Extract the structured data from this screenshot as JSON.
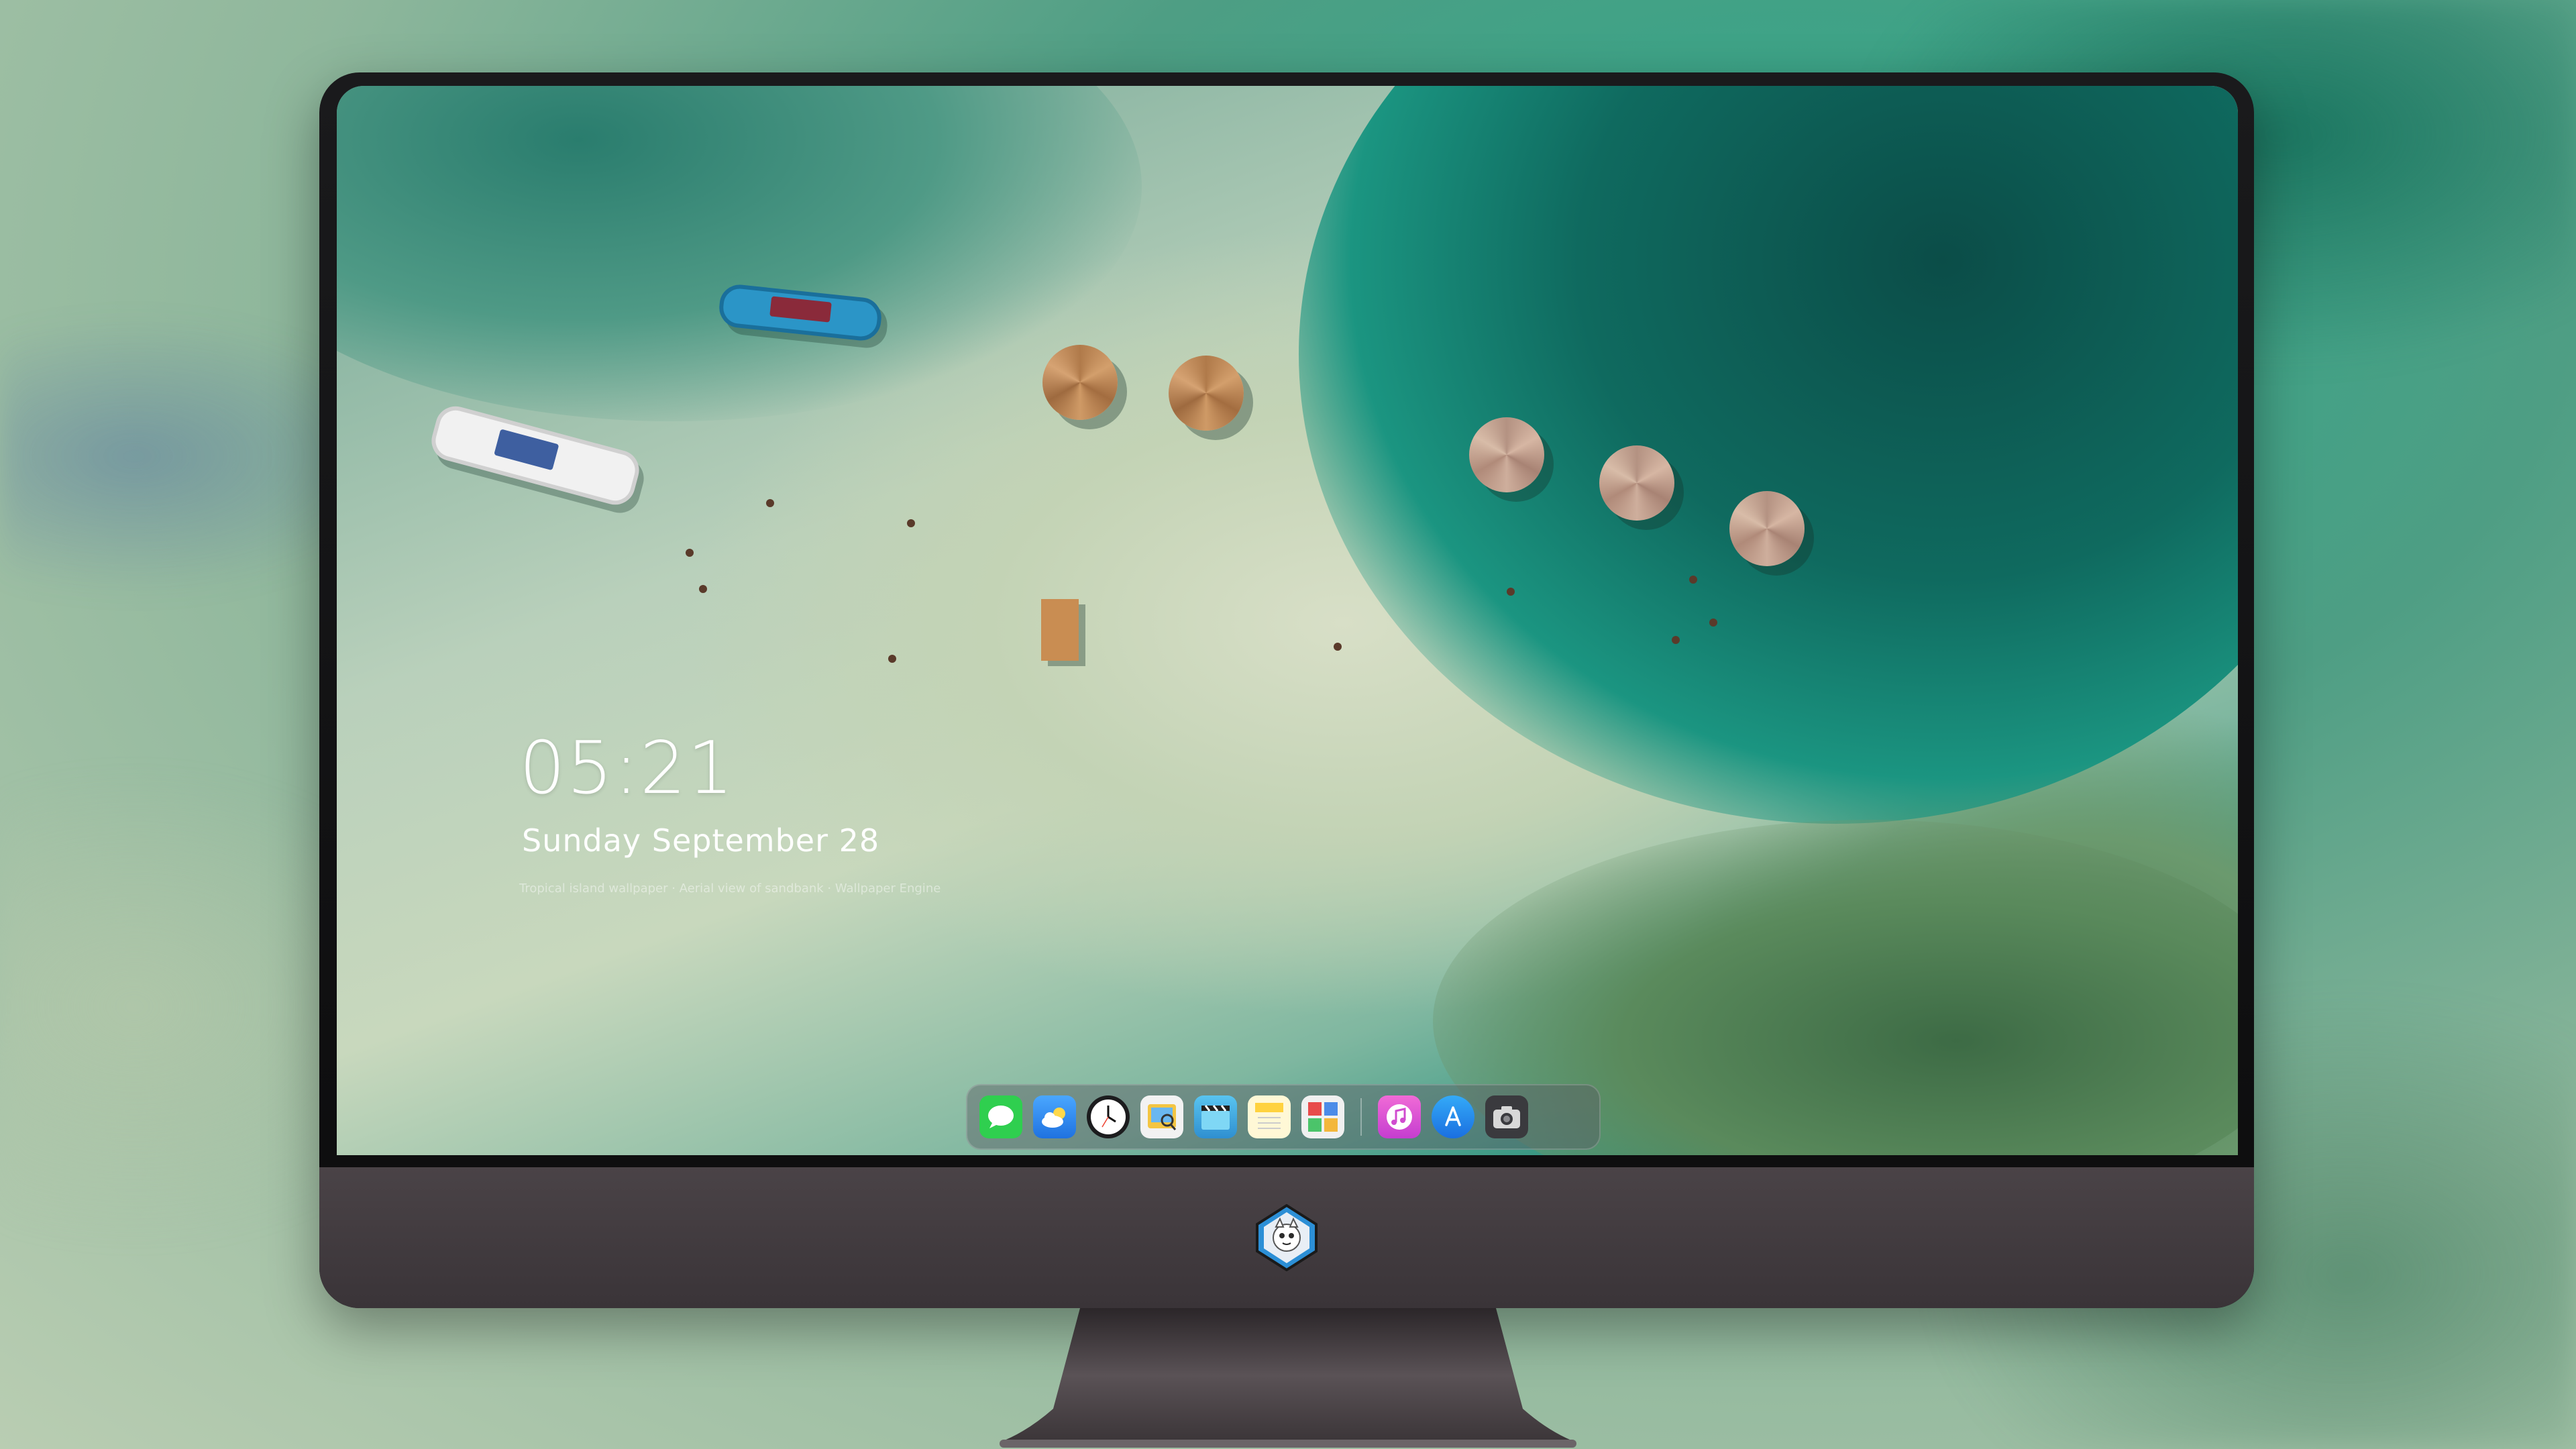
{
  "lock_screen": {
    "time": "05:21",
    "date": "Sunday September 28",
    "wallpaper_credit": "Tropical island wallpaper · Aerial view of sandbank · Wallpaper Engine"
  },
  "dock": {
    "apps": [
      {
        "name": "messages-icon",
        "color": "#2fcf4f"
      },
      {
        "name": "weather-icon",
        "color": "#2f8ff0"
      },
      {
        "name": "clock-icon",
        "color": "#1c1c1e"
      },
      {
        "name": "preview-icon",
        "color": "#f4c542"
      },
      {
        "name": "final-cut-icon",
        "color": "#3fb3e8"
      },
      {
        "name": "notes-icon",
        "color": "#ffd23f"
      },
      {
        "name": "photo-booth-icon",
        "color": "#e84b4b"
      },
      {
        "name": "itunes-icon",
        "color": "#e35bc9"
      },
      {
        "name": "app-store-icon",
        "color": "#1e8ff5"
      },
      {
        "name": "screenshot-icon",
        "color": "#4a4a4e"
      }
    ]
  },
  "colors": {
    "dock_background": "#5a5a64",
    "monitor_chin": "#433c40",
    "monitor_bezel": "#141416"
  }
}
